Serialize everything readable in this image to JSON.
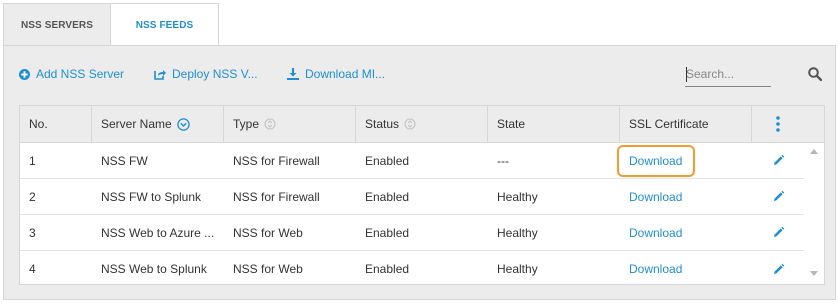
{
  "tabs": [
    {
      "label": "NSS SERVERS",
      "active": false
    },
    {
      "label": "NSS FEEDS",
      "active": true
    }
  ],
  "toolbar": {
    "add_label": "Add NSS Server",
    "deploy_label": "Deploy NSS V...",
    "download_label": "Download MI...",
    "accent_color": "#1f8fd0"
  },
  "search": {
    "placeholder": "Search...",
    "value": ""
  },
  "table": {
    "columns": [
      "No.",
      "Server Name",
      "Type",
      "Status",
      "State",
      "SSL Certificate"
    ],
    "rows": [
      {
        "no": "1",
        "name": "NSS FW",
        "type": "NSS for Firewall",
        "status": "Enabled",
        "state": "---",
        "ssl": "Download"
      },
      {
        "no": "2",
        "name": "NSS FW to Splunk",
        "type": "NSS for Firewall",
        "status": "Enabled",
        "state": "Healthy",
        "ssl": "Download"
      },
      {
        "no": "3",
        "name": "NSS Web to Azure ...",
        "type": "NSS for Web",
        "status": "Enabled",
        "state": "Healthy",
        "ssl": "Download"
      },
      {
        "no": "4",
        "name": "NSS Web to Splunk",
        "type": "NSS for Web",
        "status": "Enabled",
        "state": "Healthy",
        "ssl": "Download"
      }
    ]
  },
  "highlight_color": "#f29b2f"
}
